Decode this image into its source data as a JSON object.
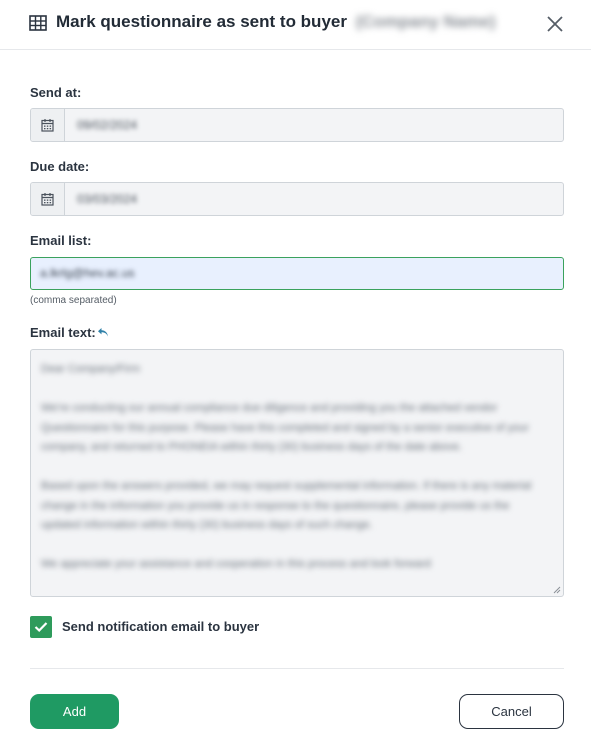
{
  "header": {
    "title": "Mark questionnaire as sent to buyer",
    "title_suffix_blurred": "(Company Name)",
    "icon": "table-grid-icon",
    "close_icon": "close-icon"
  },
  "form": {
    "send_at": {
      "label": "Send at:",
      "value": "09/02/2024",
      "icon": "calendar-icon"
    },
    "due_date": {
      "label": "Due date:",
      "value": "03/03/2024",
      "icon": "calendar-icon"
    },
    "email_list": {
      "label": "Email list:",
      "value": "a.lkrlg@hev.ac.us",
      "hint": "(comma separated)"
    },
    "email_text": {
      "label": "Email text:",
      "reset_icon": "undo-icon",
      "paragraphs": [
        "Dear Company/Firm",
        "We're conducting our annual compliance due diligence and providing you the attached vendor Questionnaire for this purpose. Please have this completed and signed by a senior executive of your company, and returned to PHONEIA within thirty (30) business days of the date above.",
        "Based upon the answers provided, we may request supplemental information. If there is any material change in the information you provide us in response to the questionnaire, please provide us the updated information within thirty (30) business days of such change.",
        "We appreciate your assistance and cooperation in this process and look forward"
      ]
    },
    "notify": {
      "label": "Send notification email to buyer",
      "checked": true
    }
  },
  "actions": {
    "add_label": "Add",
    "cancel_label": "Cancel"
  },
  "colors": {
    "accent": "#1f9a63",
    "checkbox": "#2e9b5b",
    "email_focus_border": "#3aa25d",
    "autofill_bg": "#e8f0fe"
  }
}
